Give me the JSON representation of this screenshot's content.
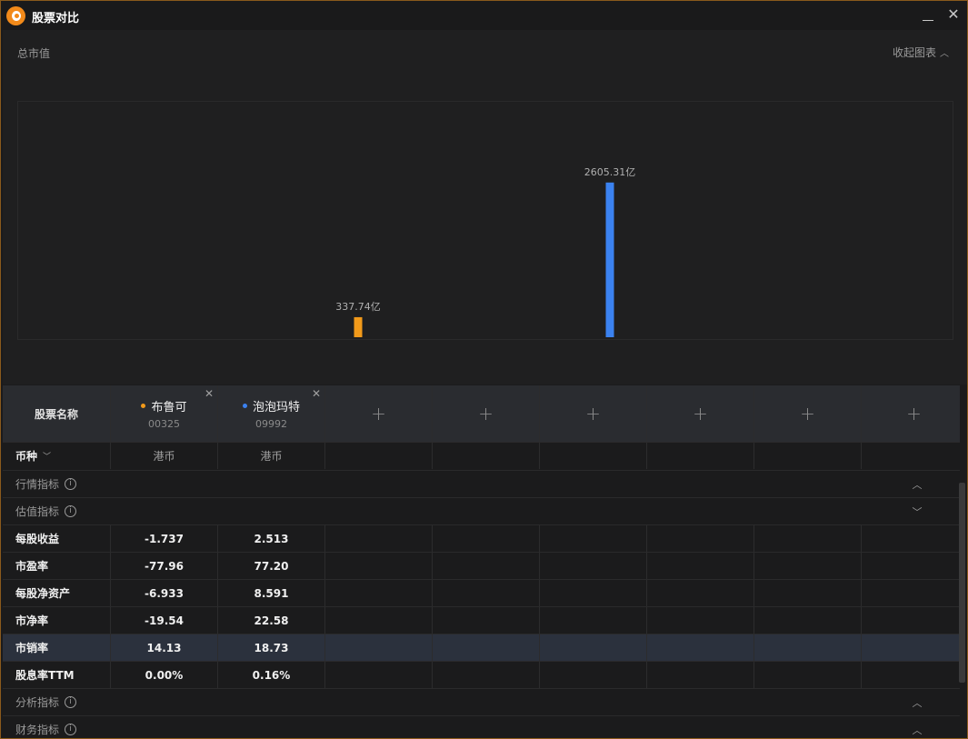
{
  "window": {
    "title": "股票对比",
    "minimize_label": "_",
    "close_label": "✕"
  },
  "chart_panel": {
    "title": "总市值",
    "collapse_label": "收起图表"
  },
  "chart_data": {
    "type": "bar",
    "title": "总市值",
    "categories": [
      "布鲁可",
      "泡泡玛特"
    ],
    "series": [
      {
        "values": [
          337.74,
          2605.31
        ]
      }
    ],
    "data_labels": [
      "337.74亿",
      "2605.31亿"
    ],
    "colors": [
      "#f29a1a",
      "#3b82f0"
    ],
    "ylim": [
      0,
      3000
    ],
    "grid": false
  },
  "table": {
    "header": {
      "label": "股票名称",
      "stocks": [
        {
          "name": "布鲁可",
          "code": "00325",
          "color": "#f29a1a"
        },
        {
          "name": "泡泡玛特",
          "code": "09992",
          "color": "#3b82f0"
        }
      ],
      "add_label": "+",
      "remove_label": "✕"
    },
    "currency_row": {
      "label": "币种",
      "values": [
        "港币",
        "港币"
      ]
    },
    "sections": {
      "market": "行情指标",
      "valuation": "估值指标",
      "analysis": "分析指标",
      "finance": "财务指标"
    },
    "rows": [
      {
        "label": "每股收益",
        "values": [
          "-1.737",
          "2.513"
        ]
      },
      {
        "label": "市盈率",
        "values": [
          "-77.96",
          "77.20"
        ]
      },
      {
        "label": "每股净资产",
        "values": [
          "-6.933",
          "8.591"
        ]
      },
      {
        "label": "市净率",
        "values": [
          "-19.54",
          "22.58"
        ]
      },
      {
        "label": "市销率",
        "values": [
          "14.13",
          "18.73"
        ]
      },
      {
        "label": "股息率TTM",
        "values": [
          "0.00%",
          "0.16%"
        ]
      }
    ]
  },
  "icons": {
    "info": "i",
    "chevron_up": "︿",
    "chevron_down": "﹀"
  }
}
